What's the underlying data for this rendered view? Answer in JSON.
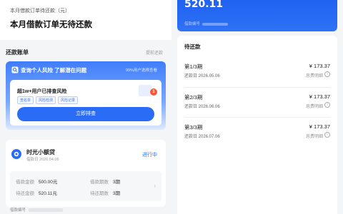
{
  "left": {
    "month_sub": "本月借款订单待还款（元）",
    "month_main": "本月借款订单无待还款",
    "section_title": "还款账单",
    "section_link": "提前还款",
    "risk": {
      "header": "查询个人风险 了解潜在问题",
      "header_right": "99%用户选择查看",
      "inner_title": "超1w+用户已排查风险",
      "tags": [
        "查名单",
        "风险检测",
        "风险记录"
      ],
      "badge": "1",
      "button": "立即排查"
    },
    "loan": {
      "name": "时光小额贷",
      "date": "借款日 2026.04.06",
      "status": "进行中",
      "borrow_label": "借款金额",
      "borrow_value": "500.00元",
      "periods_label": "借款期数",
      "periods_value": "3期",
      "pending_amount_label": "待还金额",
      "pending_amount_value": "520.11元",
      "pending_periods_label": "待还期数",
      "pending_periods_value": "3期",
      "arrow": "›"
    },
    "contract_label": "借款编号"
  },
  "right": {
    "amount": "520.11",
    "contract_label": "借款编号",
    "pay_title": "待还款",
    "periods": [
      {
        "name": "第1/3期",
        "date": "还款日 2026.05.06",
        "amount": "¥ 173.37",
        "link": "息费明细"
      },
      {
        "name": "第2/3期",
        "date": "还款日 2026.06.06",
        "amount": "¥ 173.37",
        "link": "息费明细"
      },
      {
        "name": "第3/3期",
        "date": "还款日 2026.07.06",
        "amount": "¥ 173.37",
        "link": "息费明细"
      }
    ],
    "info_icon": "i"
  },
  "colors": {
    "accent": "#2a6cf6",
    "badge": "#f25a3a"
  },
  "icons": {
    "risk": "shield-icon",
    "loan": "brand-logo-icon",
    "info": "info-icon",
    "arrow": "chevron-right-icon"
  }
}
